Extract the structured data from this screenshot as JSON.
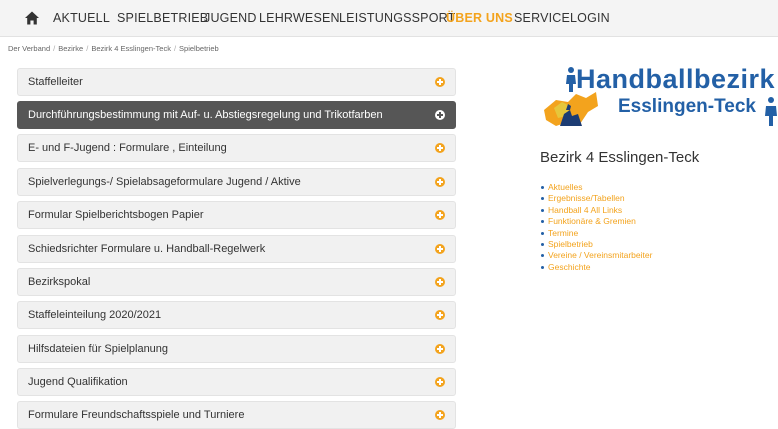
{
  "nav": {
    "home_icon": "home-icon",
    "items": [
      {
        "label": "AKTUELL",
        "active": false
      },
      {
        "label": "SPIELBETRIEB",
        "active": false
      },
      {
        "label": "JUGEND",
        "active": false
      },
      {
        "label": "LEHRWESEN",
        "active": false
      },
      {
        "label": "LEISTUNGSSPORT",
        "active": false
      },
      {
        "label": "ÜBER UNS",
        "active": true
      },
      {
        "label": "SERVICE",
        "active": false
      },
      {
        "label": "LOGIN",
        "active": false
      }
    ]
  },
  "breadcrumb": [
    "Der Verband",
    "Bezirke",
    "Bezirk 4 Esslingen-Teck",
    "Spielbetrieb"
  ],
  "accordion": [
    {
      "label": "Staffelleiter",
      "active": false
    },
    {
      "label": "Durchführungsbestimmung mit Auf- u. Abstiegsregelung und Trikotfarben",
      "active": true
    },
    {
      "label": "E- und F-Jugend : Formulare , Einteilung",
      "active": false
    },
    {
      "label": "Spielverlegungs-/ Spielabsageformulare Jugend / Aktive",
      "active": false
    },
    {
      "label": "Formular Spielberichtsbogen Papier",
      "active": false
    },
    {
      "label": "Schiedsrichter Formulare u. Handball-Regelwerk",
      "active": false
    },
    {
      "label": "Bezirkspokal",
      "active": false
    },
    {
      "label": "Staffeleinteilung 2020/2021",
      "active": false
    },
    {
      "label": "Hilfsdateien für Spielplanung",
      "active": false
    },
    {
      "label": "Jugend Qualifikation",
      "active": false
    },
    {
      "label": "Formulare Freundschaftsspiele und Turniere",
      "active": false
    }
  ],
  "logo": {
    "line1": "Handballbezirk",
    "line2": "Esslingen-Teck",
    "color": "#2360a6"
  },
  "region_title": "Bezirk 4 Esslingen-Teck",
  "side_links": [
    "Aktuelles",
    "Ergebnisse/Tabellen",
    "Handball 4 All Links",
    "Funktionäre & Gremien",
    "Termine",
    "Spielbetrieb",
    "Vereine / Vereinsmitarbeiter",
    "Geschichte"
  ],
  "colors": {
    "accent": "#f3a31d",
    "active_panel": "#565656",
    "brand_blue": "#2360a6"
  }
}
